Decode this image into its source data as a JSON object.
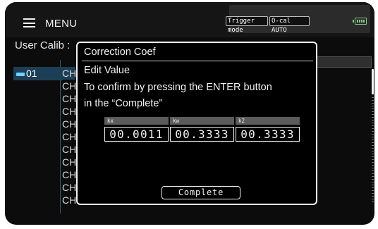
{
  "header": {
    "menu_label": "MENU",
    "trigger_badge": "Trigger mode",
    "ocal_badge": "O-cal AUTO"
  },
  "background": {
    "page_title": "User Calib :",
    "channel_label": "01",
    "ch_rows": [
      "CH",
      "CH",
      "CH",
      "CH",
      "CH",
      "CH",
      "CH",
      "CH",
      "CH",
      "CH",
      "CH"
    ]
  },
  "dialog": {
    "title": "Correction Coef",
    "heading": "Edit Value",
    "instruction_line1": "To confirm by pressing the ENTER button",
    "instruction_line2": "in the “Complete”",
    "coefficients": [
      {
        "label": "kx",
        "value": "00.0011"
      },
      {
        "label": "kw",
        "value": "00.3333"
      },
      {
        "label": "k2",
        "value": "00.3333"
      }
    ],
    "complete_label": "Complete"
  },
  "colors": {
    "background": "#0c0c0c",
    "text": "#f2f2f2",
    "selection": "#1d3f55",
    "channel_icon": "#6cd2ff",
    "battery": "#7fc97f"
  }
}
